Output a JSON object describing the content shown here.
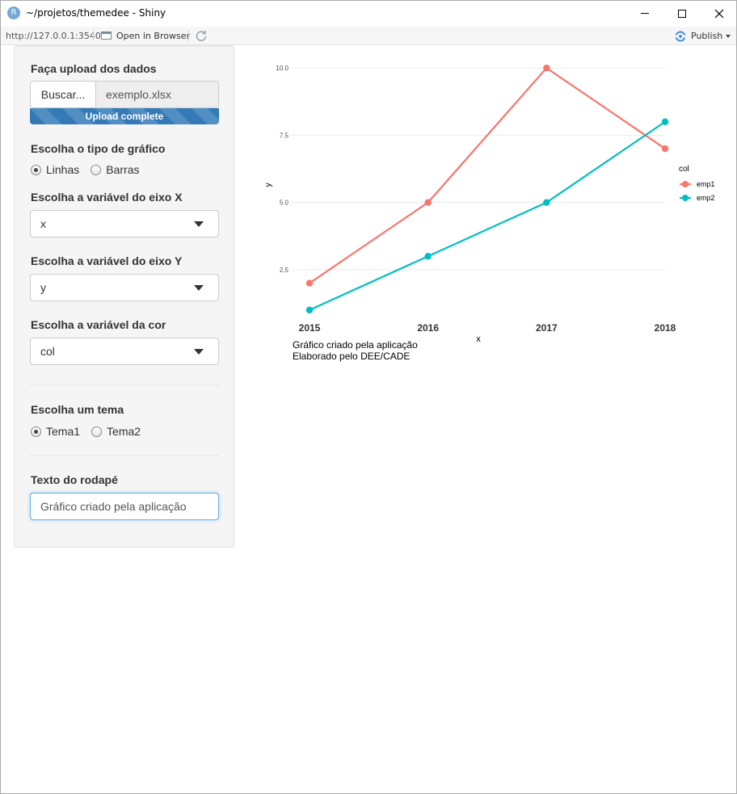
{
  "window": {
    "title": "~/projetos/themedee - Shiny",
    "app_icon_letter": "R"
  },
  "toolbar": {
    "url": "http://127.0.0.1:3540",
    "open_in_browser": "Open in Browser",
    "publish": "Publish"
  },
  "sidebar": {
    "upload": {
      "label": "Faça upload dos dados",
      "button": "Buscar...",
      "file_name": "exemplo.xlsx",
      "progress_text": "Upload complete",
      "progress": 1.0
    },
    "chart_type": {
      "label": "Escolha o tipo de gráfico",
      "options": [
        {
          "label": "Linhas",
          "checked": true
        },
        {
          "label": "Barras",
          "checked": false
        }
      ]
    },
    "x_var": {
      "label": "Escolha a variável do eixo X",
      "value": "x"
    },
    "y_var": {
      "label": "Escolha a variável do eixo Y",
      "value": "y"
    },
    "color_var": {
      "label": "Escolha a variável da cor",
      "value": "col"
    },
    "theme": {
      "label": "Escolha um tema",
      "options": [
        {
          "label": "Tema1",
          "checked": true
        },
        {
          "label": "Tema2",
          "checked": false
        }
      ]
    },
    "footer": {
      "label": "Texto do rodapé",
      "value": "Gráfico criado pela aplicação"
    }
  },
  "chart_data": {
    "type": "line",
    "x": [
      "2015",
      "2016",
      "2017",
      "2018"
    ],
    "series": [
      {
        "name": "emp1",
        "values": [
          2,
          5,
          10,
          7
        ],
        "color": "#f8766d"
      },
      {
        "name": "emp2",
        "values": [
          1,
          3,
          5,
          8
        ],
        "color": "#00bfc4"
      }
    ],
    "xlabel": "x",
    "ylabel": "y",
    "y_ticks": [
      "2.5",
      "5.0",
      "7.5",
      "10.0"
    ],
    "ylim": [
      0.725,
      10.275
    ],
    "legend_title": "col",
    "legend_position": "right",
    "grid": "horizontal major",
    "caption": [
      "Gráfico criado pela aplicação",
      "Elaborado pelo DEE/CADE"
    ]
  }
}
